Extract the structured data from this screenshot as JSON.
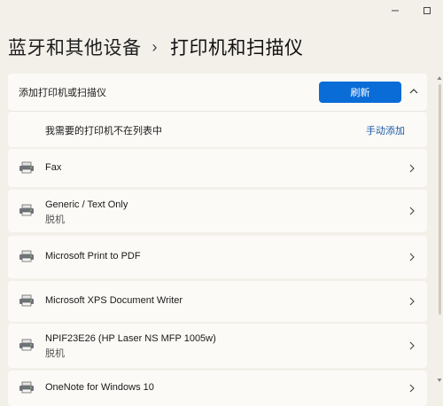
{
  "window": {
    "minimize_icon": "minimize-icon",
    "maximize_icon": "maximize-icon"
  },
  "breadcrumb": {
    "parent": "蓝牙和其他设备",
    "separator": "›",
    "current": "打印机和扫描仪"
  },
  "add_section": {
    "label": "添加打印机或扫描仪",
    "refresh_label": "刷新",
    "not_listed_label": "我需要的打印机不在列表中",
    "manual_add_label": "手动添加"
  },
  "printers": [
    {
      "name": "Fax",
      "status": ""
    },
    {
      "name": "Generic / Text Only",
      "status": "脱机"
    },
    {
      "name": "Microsoft Print to PDF",
      "status": ""
    },
    {
      "name": "Microsoft XPS Document Writer",
      "status": ""
    },
    {
      "name": "NPIF23E26 (HP Laser NS MFP 1005w)",
      "status": "脱机"
    },
    {
      "name": "OneNote for Windows 10",
      "status": ""
    }
  ],
  "colors": {
    "accent": "#0a6cd6",
    "link": "#1d58a8",
    "background": "#f3f0ea",
    "card": "#fbfaf7"
  }
}
